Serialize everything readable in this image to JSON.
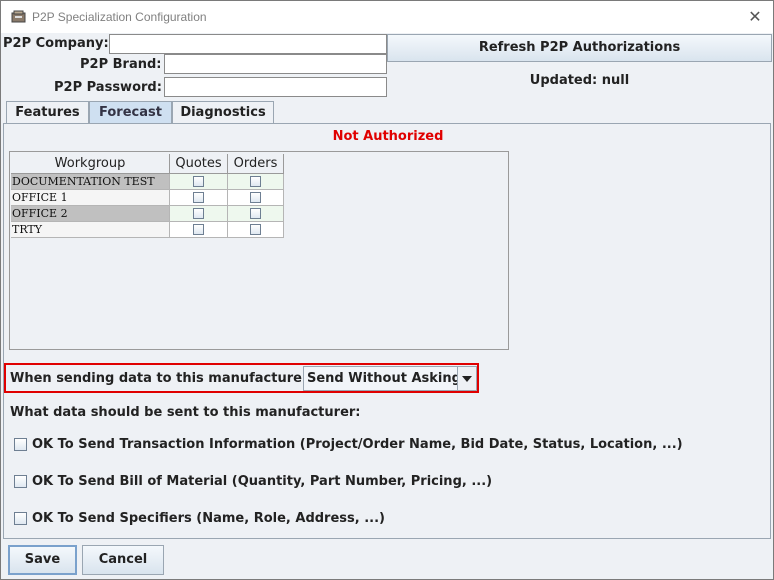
{
  "window": {
    "title": "P2P Specialization Configuration",
    "close_glyph": "✕"
  },
  "credentials": {
    "company_label": "P2P Company:",
    "company_value": "",
    "brand_label": "P2P Brand:",
    "brand_value": "",
    "password_label": "P2P Password:",
    "password_value": ""
  },
  "refresh_button": "Refresh P2P Authorizations",
  "updated_text": "Updated: null",
  "tabs": [
    {
      "label": "Features",
      "active": false
    },
    {
      "label": "Forecast",
      "active": true
    },
    {
      "label": "Diagnostics",
      "active": false
    }
  ],
  "status": "Not Authorized",
  "table": {
    "headers": [
      "Workgroup",
      "Quotes",
      "Orders"
    ],
    "rows": [
      {
        "workgroup": "DOCUMENTATION TEST",
        "quotes": false,
        "orders": false
      },
      {
        "workgroup": "OFFICE 1",
        "quotes": false,
        "orders": false
      },
      {
        "workgroup": "OFFICE 2",
        "quotes": false,
        "orders": false
      },
      {
        "workgroup": "TRTY",
        "quotes": false,
        "orders": false
      }
    ]
  },
  "send_mode": {
    "label": "When sending data to this manufacturer:",
    "value": "Send Without Asking"
  },
  "data_question": "What data should be sent to this manufacturer:",
  "options": [
    {
      "label": "OK To Send Transaction Information  (Project/Order Name, Bid Date, Status, Location, ...)",
      "checked": false
    },
    {
      "label": "OK To Send Bill of Material  (Quantity, Part Number, Pricing, ...)",
      "checked": false
    },
    {
      "label": "OK To Send Specifiers  (Name, Role, Address, ...)",
      "checked": false
    }
  ],
  "buttons": {
    "save": "Save",
    "cancel": "Cancel"
  },
  "colors": {
    "error": "#e00000",
    "highlight_box": "#e00000",
    "active_tab": "#cfe0f1"
  }
}
